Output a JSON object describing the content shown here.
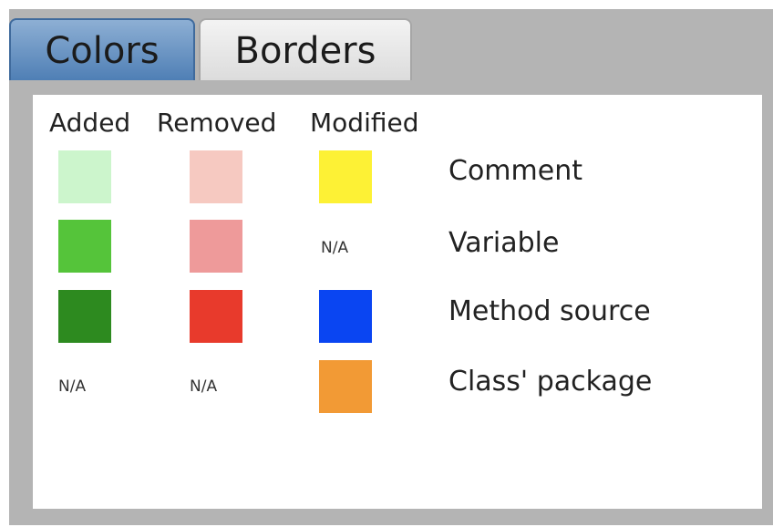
{
  "tabs": [
    {
      "label": "Colors"
    },
    {
      "label": "Borders"
    }
  ],
  "columns": [
    "Added",
    "Removed",
    "Modified"
  ],
  "rows": [
    {
      "label": "Comment",
      "added": "#ccf5cc",
      "removed": "#f6c9c1",
      "modified": "#fdf135"
    },
    {
      "label": "Variable",
      "added": "#55c43a",
      "removed": "#ee9a9a",
      "modified": "N/A"
    },
    {
      "label": "Method source",
      "added": "#2d8a1f",
      "removed": "#e83a2c",
      "modified": "#0a45f2"
    },
    {
      "label": "Class' package",
      "added": "N/A",
      "removed": "N/A",
      "modified": "#f29a35"
    }
  ],
  "accent_tab_color": "#4f7fb5"
}
